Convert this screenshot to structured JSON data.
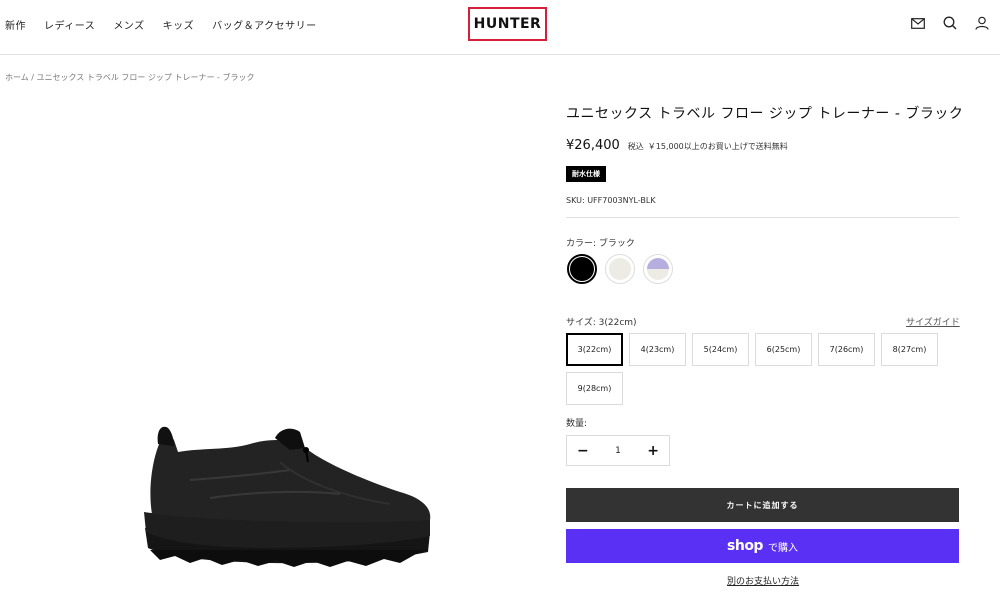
{
  "header": {
    "nav": [
      "新作",
      "レディース",
      "メンズ",
      "キッズ",
      "バッグ＆アクセサリー"
    ],
    "logo": "HUNTER",
    "icons": [
      "mail-icon",
      "search-icon",
      "account-icon",
      "cart-icon"
    ]
  },
  "breadcrumb": "ホーム / ユニセックス トラベル フロー ジップ トレーナー - ブラック",
  "product": {
    "title": "ユニセックス トラベル フロー ジップ トレーナー - ブラック",
    "price": "¥26,400",
    "tax": "税込",
    "shipping": "￥15,000以上のお買い上げで送料無料",
    "badge": "耐水仕様",
    "sku": "SKU: UFF7003NYL-BLK",
    "color_label": "カラー: ブラック",
    "colors": [
      "#000000",
      "#ecebe4",
      "#b7aee0"
    ],
    "size_label": "サイズ: 3(22cm)",
    "size_guide": "サイズガイド",
    "sizes": [
      "3(22cm)",
      "4(23cm)",
      "5(24cm)",
      "6(25cm)",
      "7(26cm)",
      "8(27cm)",
      "9(28cm)"
    ],
    "selected_size": "3(22cm)",
    "qty_label": "数量:",
    "qty_value": "1",
    "add_to_cart": "カートに追加する",
    "shop_logo": "shop",
    "shop_pay": "で購入",
    "other_payment": "別のお支払い方法"
  },
  "colors": {
    "logo_border": "#d6203a",
    "cart_button": "#333333",
    "shop_pay": "#5a31f4"
  }
}
